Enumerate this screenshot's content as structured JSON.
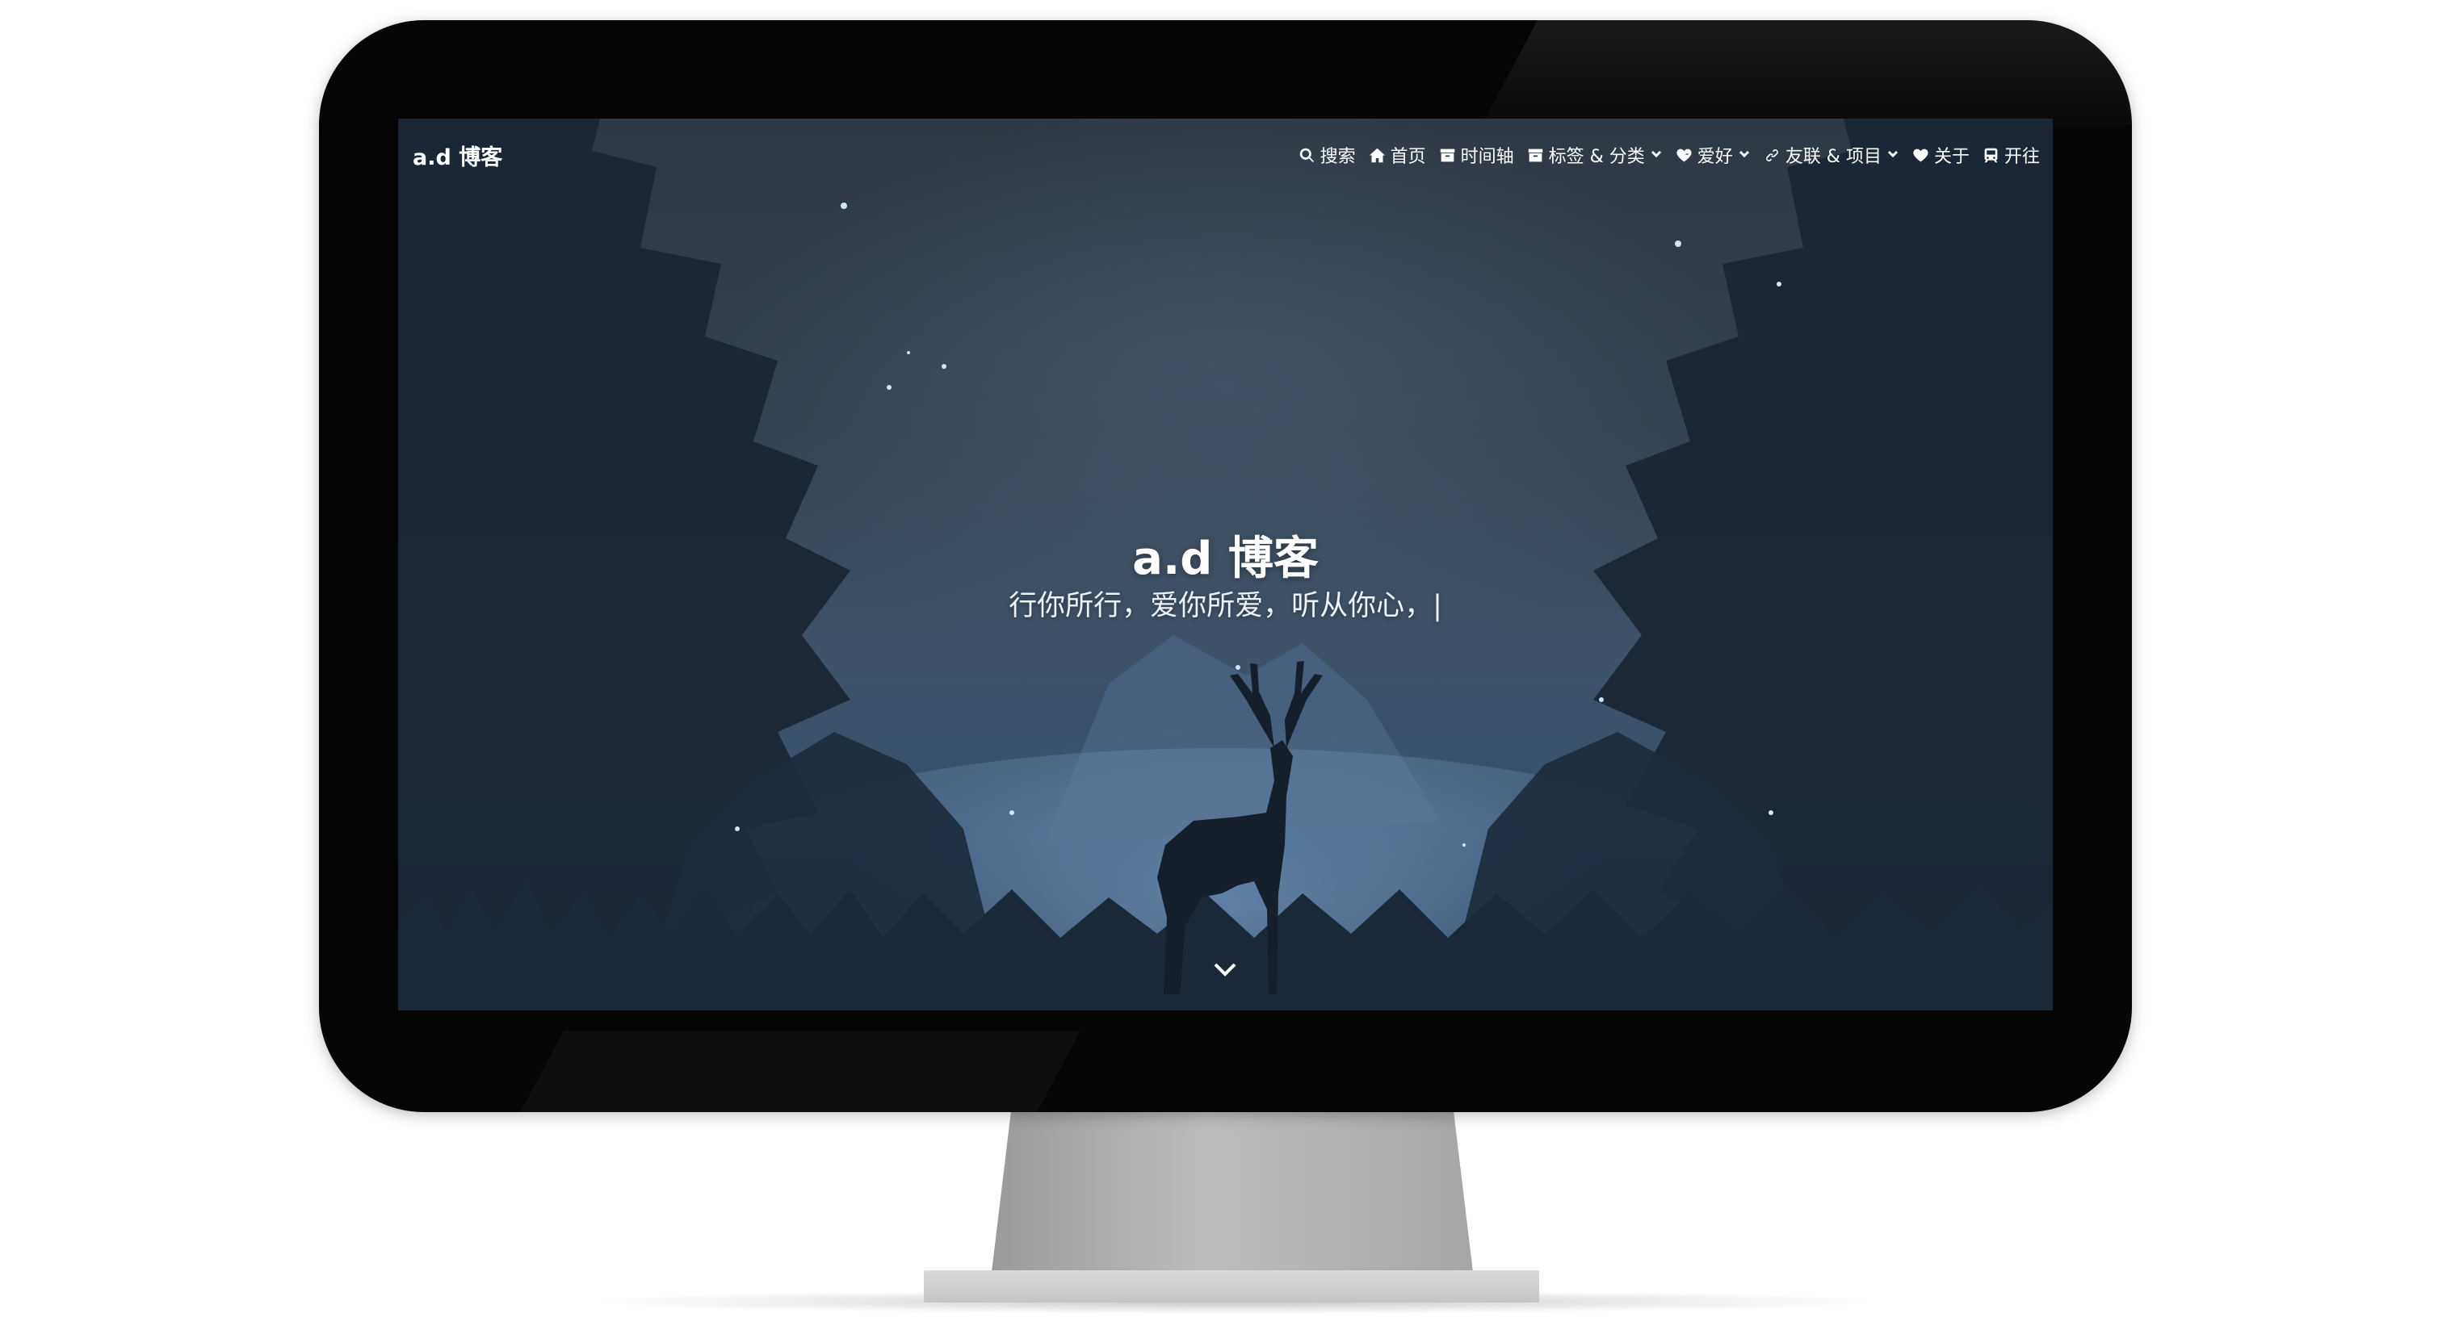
{
  "site": {
    "brand": "a.d 博客",
    "nav": [
      {
        "icon": "search-icon",
        "label": "搜索",
        "dropdown": false
      },
      {
        "icon": "home-icon",
        "label": "首页",
        "dropdown": false
      },
      {
        "icon": "archive-icon",
        "label": "时间轴",
        "dropdown": false
      },
      {
        "icon": "archive-icon",
        "label": "标签 & 分类",
        "dropdown": true
      },
      {
        "icon": "heart-pulse-icon",
        "label": "爱好",
        "dropdown": true
      },
      {
        "icon": "link-icon",
        "label": "友联 & 项目",
        "dropdown": true
      },
      {
        "icon": "heart-icon",
        "label": "关于",
        "dropdown": false
      },
      {
        "icon": "subway-icon",
        "label": "开往",
        "dropdown": false
      }
    ]
  },
  "hero": {
    "title": "a.d 博客",
    "subtitle": "行你所行，爱你所爱，听从你心，|"
  },
  "colors": {
    "bezel": "#050505",
    "sky_top": "#2e3944",
    "mist": "#3f5268",
    "text": "#ffffff"
  }
}
